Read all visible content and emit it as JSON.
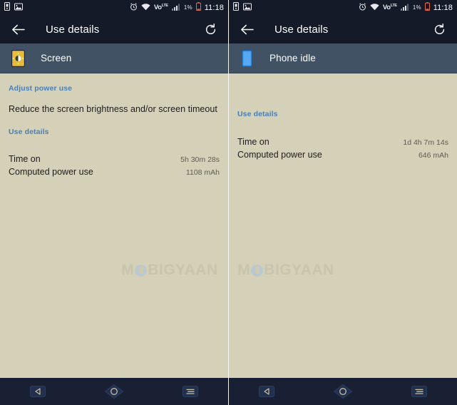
{
  "statusbar": {
    "icons_left": [
      "sim-card-icon",
      "image-icon"
    ],
    "icons_right": [
      "alarm-icon",
      "wifi-icon",
      "volte-icon",
      "signal-icon"
    ],
    "volte_label": "Vo",
    "volte_sup": "LTE",
    "battery_percent": "1%",
    "battery_icon": "battery-icon",
    "time": "11:18"
  },
  "appbar": {
    "back_icon": "back-arrow-icon",
    "title": "Use details",
    "refresh_icon": "refresh-icon"
  },
  "screens": [
    {
      "id": "screen-left",
      "subheader": {
        "icon": "screen-brightness-icon",
        "icon_color": "#e8bc3c",
        "title": "Screen"
      },
      "adjust_heading": "Adjust power use",
      "adjust_description": "Reduce the screen brightness and/or screen timeout",
      "use_details_heading": "Use details",
      "rows": [
        {
          "label": "Time on",
          "value": "5h 30m 28s"
        },
        {
          "label": "Computed power use",
          "value": "1108 mAh"
        }
      ]
    },
    {
      "id": "screen-right",
      "subheader": {
        "icon": "phone-idle-icon",
        "icon_color": "#3b9bf0",
        "title": "Phone idle"
      },
      "adjust_heading": "",
      "adjust_description": "",
      "use_details_heading": "Use details",
      "rows": [
        {
          "label": "Time on",
          "value": "1d 4h 7m 14s"
        },
        {
          "label": "Computed power use",
          "value": "646 mAh"
        }
      ]
    }
  ],
  "watermark": {
    "part_a": "M",
    "part_b": "BIGYAAN"
  },
  "navbar": {
    "back_icon": "nav-back-icon",
    "home_icon": "nav-home-icon",
    "recents_icon": "nav-recents-icon"
  },
  "colors": {
    "statusbar_bg": "#151a28",
    "appbar_bg": "#151a28",
    "subheader_bg": "#415265",
    "content_bg": "#d5d1b8",
    "link_blue": "#4a7fb5",
    "navbar_bg": "#192034",
    "nav_icon": "#c8bf96"
  }
}
